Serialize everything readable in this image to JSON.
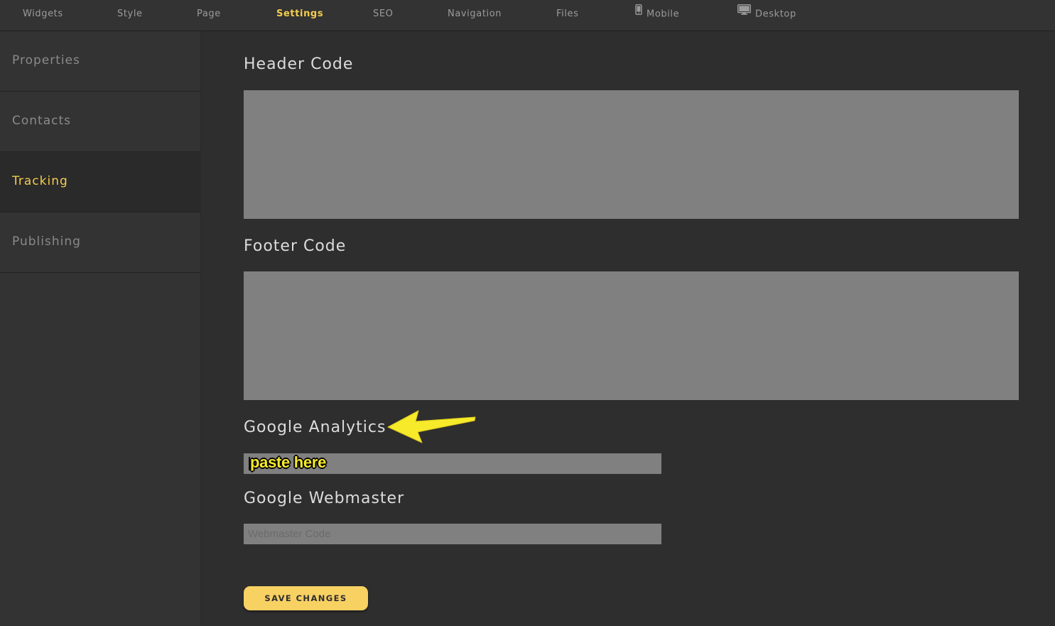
{
  "topnav": {
    "tabs": [
      {
        "label": "Widgets"
      },
      {
        "label": "Style"
      },
      {
        "label": "Page"
      },
      {
        "label": "Settings"
      },
      {
        "label": "SEO"
      },
      {
        "label": "Navigation"
      },
      {
        "label": "Files"
      },
      {
        "label": "Mobile",
        "icon": "mobile-phone-icon"
      },
      {
        "label": "Desktop",
        "icon": "desktop-monitor-icon"
      }
    ],
    "active": "Settings"
  },
  "sidebar": {
    "items": [
      {
        "label": "Properties"
      },
      {
        "label": "Contacts"
      },
      {
        "label": "Tracking"
      },
      {
        "label": "Publishing"
      }
    ],
    "active": "Tracking"
  },
  "form": {
    "header_code_label": "Header Code",
    "header_code_value": "",
    "footer_code_label": "Footer Code",
    "footer_code_value": "",
    "google_analytics_label": "Google Analytics",
    "google_analytics_value": "",
    "google_analytics_annotation": "paste here",
    "google_webmaster_label": "Google Webmaster",
    "google_webmaster_placeholder": "Webmaster Code",
    "save_label": "SAVE CHANGES"
  },
  "annotation": {
    "arrow_color": "#f7ea2a",
    "arrow_icon": "arrow-left-icon"
  },
  "colors": {
    "accent": "#f5cc4e",
    "background": "#2e2e2e",
    "panel": "#333333",
    "field": "#808080",
    "button": "#f8d163"
  }
}
